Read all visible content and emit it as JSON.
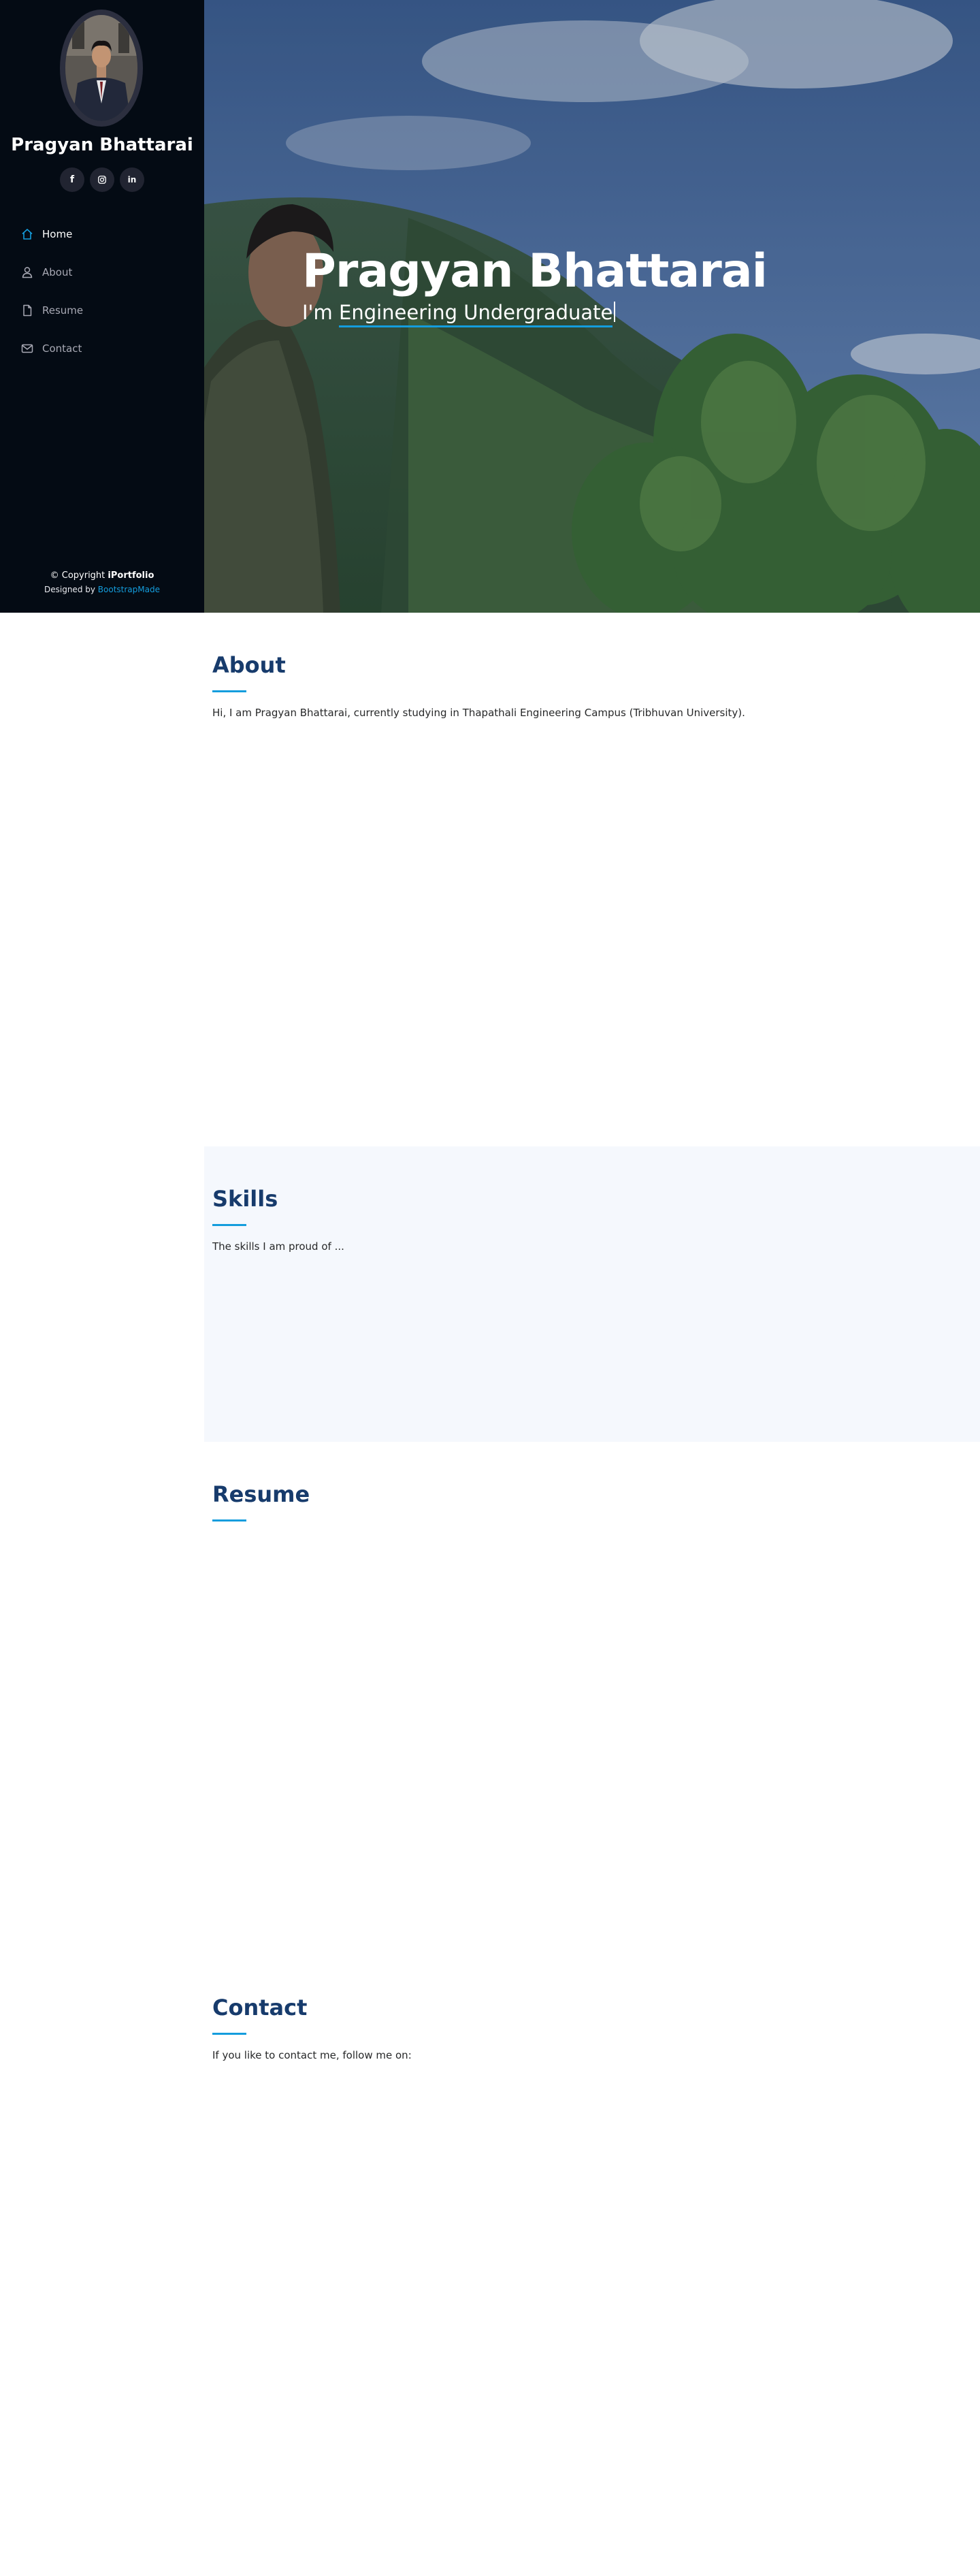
{
  "profile": {
    "name": "Pragyan Bhattarai"
  },
  "socials": [
    {
      "name": "facebook",
      "icon": "facebook-icon",
      "glyph": "f"
    },
    {
      "name": "instagram",
      "icon": "instagram-icon",
      "glyph": ""
    },
    {
      "name": "linkedin",
      "icon": "linkedin-icon",
      "glyph": "in"
    }
  ],
  "nav": {
    "items": [
      {
        "label": "Home",
        "icon": "home-icon",
        "active": true
      },
      {
        "label": "About",
        "icon": "person-icon",
        "active": false
      },
      {
        "label": "Resume",
        "icon": "file-icon",
        "active": false
      },
      {
        "label": "Contact",
        "icon": "envelope-icon",
        "active": false
      }
    ]
  },
  "footer": {
    "copyright_prefix": "© Copyright ",
    "brand": "iPortfolio",
    "designed_prefix": "Designed by ",
    "designed_link": "BootstrapMade"
  },
  "hero": {
    "title": "Pragyan Bhattarai",
    "subtitle_prefix": "I'm ",
    "subtitle_typed": "Engineering Undergraduate"
  },
  "about": {
    "title": "About",
    "text": "Hi, I am Pragyan Bhattarai, currently studying in Thapathali Engineering Campus (Tribhuvan University)."
  },
  "skills": {
    "title": "Skills",
    "text": "The skills I am proud of ..."
  },
  "resume": {
    "title": "Resume"
  },
  "contact": {
    "title": "Contact",
    "text": "If you like to contact me, follow me on:"
  },
  "colors": {
    "sidebar_bg": "#040b14",
    "accent": "#149ddd",
    "heading": "#173b6c",
    "alt_section_bg": "#f5f8fd"
  }
}
